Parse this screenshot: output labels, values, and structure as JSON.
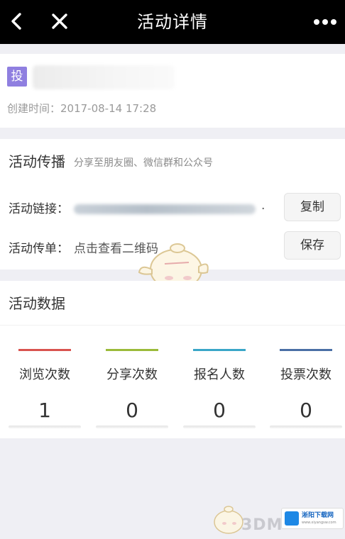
{
  "nav": {
    "title": "活动详情"
  },
  "activity": {
    "badge": "投",
    "created": "创建时间：2017-08-14 17:28"
  },
  "share": {
    "title": "活动传播",
    "subtitle": "分享至朋友圈、微信群和公众号",
    "link_label": "活动链接：",
    "link_trailing": ".",
    "copy_button": "复制",
    "flyer_label": "活动传单：",
    "flyer_text": "点击查看二维码",
    "save_button": "保存"
  },
  "stats": {
    "title": "活动数据",
    "items": [
      {
        "label": "浏览次数",
        "value": "1",
        "color": "#d9534f"
      },
      {
        "label": "分享次数",
        "value": "0",
        "color": "#9bbb3a"
      },
      {
        "label": "报名人数",
        "value": "0",
        "color": "#3aa6c8"
      },
      {
        "label": "投票次数",
        "value": "0",
        "color": "#4a6fa5"
      }
    ]
  },
  "watermark": {
    "brand": "3DM",
    "site_name": "淅阳下载网",
    "site_url": "www.xiyangsw.com"
  }
}
